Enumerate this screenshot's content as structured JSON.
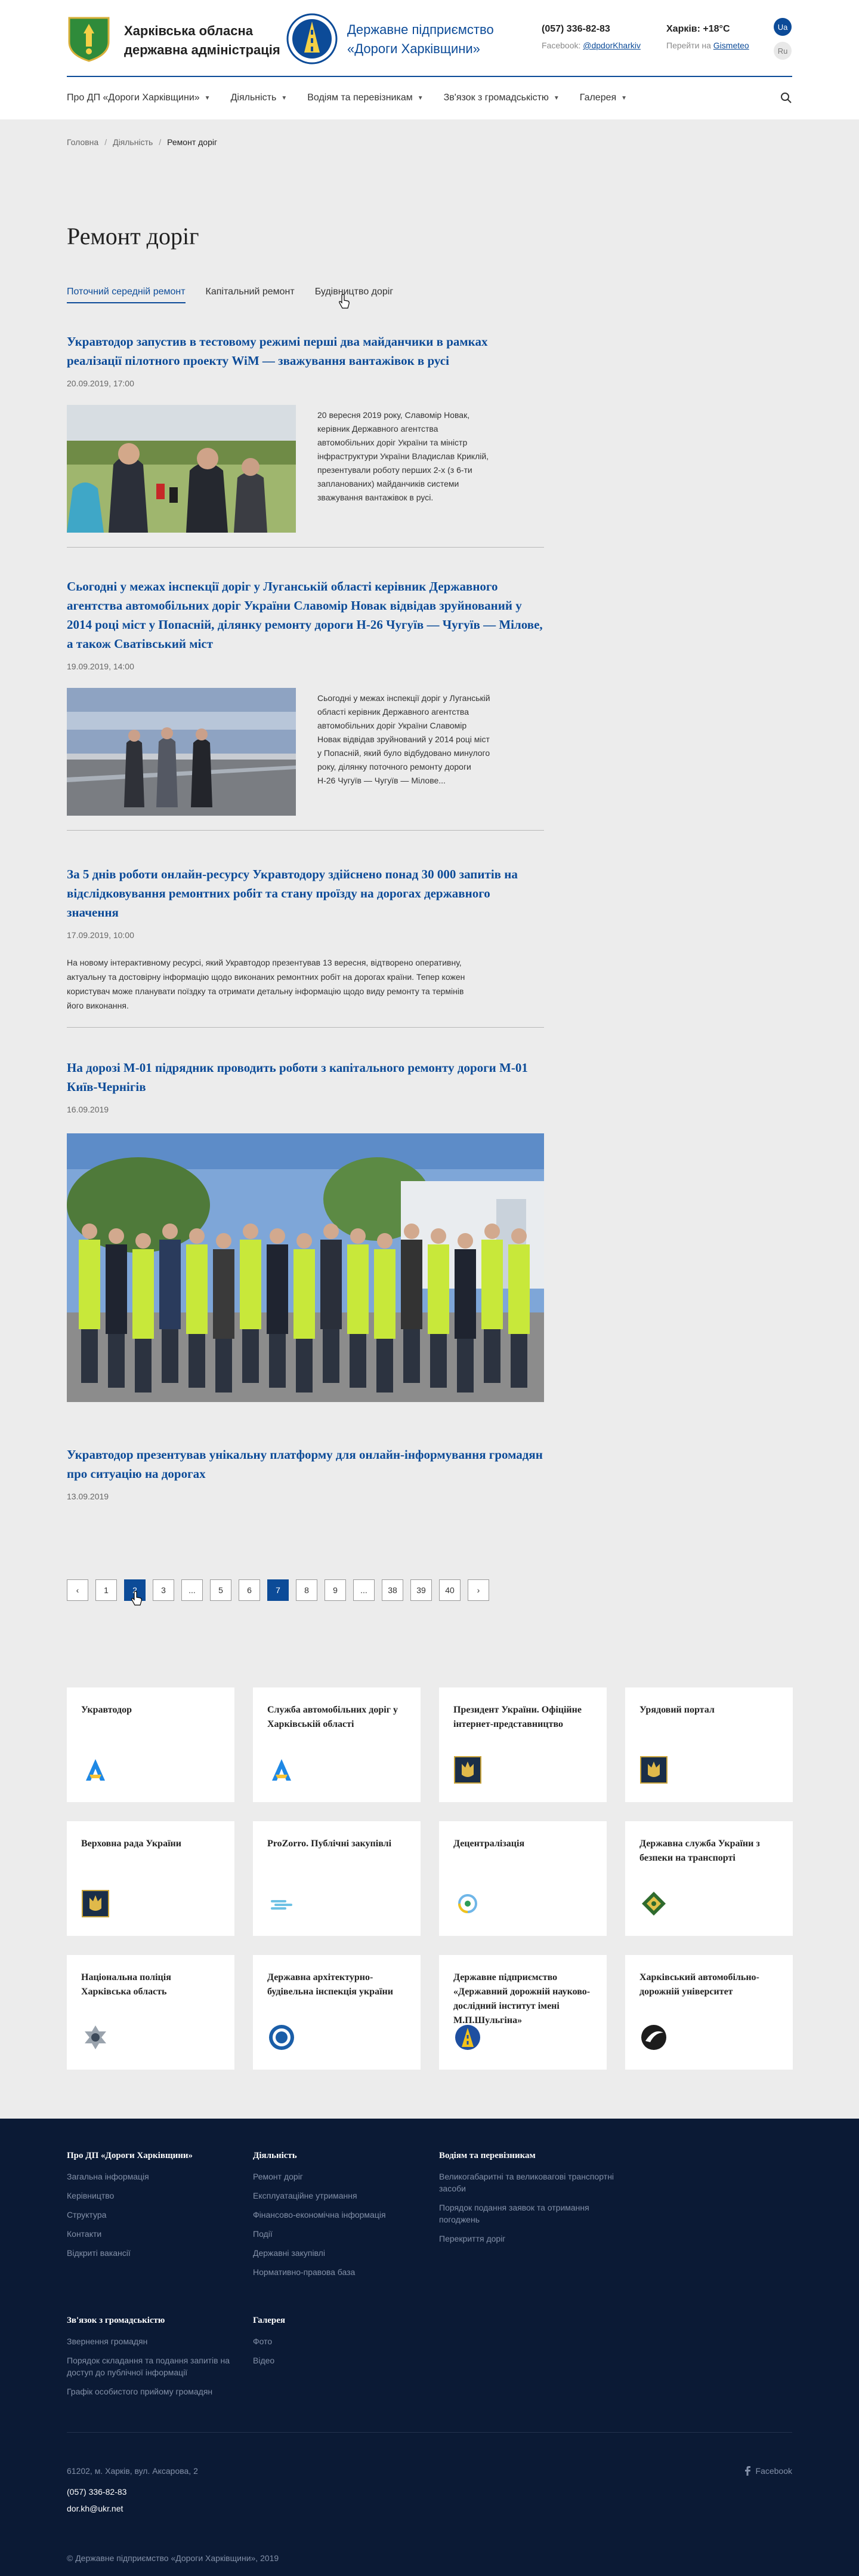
{
  "header": {
    "org1": [
      "Харківська обласна",
      "державна адміністрація"
    ],
    "org2": [
      "Державне підприємство",
      "«Дороги Харківщини»"
    ],
    "phone": "(057) 336-82-83",
    "facebook_prefix": "Facebook: ",
    "facebook_handle": "@dpdorKharkiv",
    "weather": "Харків: +18°C",
    "gismeteo_prefix": "Перейти на ",
    "gismeteo_link": "Gismeteo",
    "lang_ua": "Ua",
    "lang_ru": "Ru"
  },
  "nav": [
    {
      "label": "Про ДП «Дороги Харківщини»"
    },
    {
      "label": "Діяльність"
    },
    {
      "label": "Водіям та перевізникам"
    },
    {
      "label": "Зв'язок з громадськістю"
    },
    {
      "label": "Галерея"
    }
  ],
  "breadcrumb": [
    "Головна",
    "Діяльність",
    "Ремонт доріг"
  ],
  "page_title": "Ремонт доріг",
  "tabs": [
    "Поточний середній ремонт",
    "Капітальний ремонт",
    "Будівництво доріг"
  ],
  "articles": [
    {
      "title": "Укравтодор запустив в тестовому режимі перші два майданчики в рамках реалізації пілотного проекту WiM — зважування вантажівок в русі",
      "date": "20.09.2019, 17:00",
      "excerpt": "20 вересня 2019 року, Славомір Новак, керівник Державного агентства автомобільних доріг України та міністр інфраструктури України Владислав Криклій, презентували роботу перших 2-х (з 6-ти запланованих) майданчиків системи зважування вантажівок в русі."
    },
    {
      "title": "Сьогодні у межах інспекції доріг у Луганській області керівник Державного агентства автомобільних доріг України Славомір Новак відвідав зруйнований у 2014 році міст у Попасній, ділянку ремонту дороги Н-26 Чугуїв — Чугуїв — Мілове, а також Сватівський міст",
      "date": "19.09.2019, 14:00",
      "excerpt": "Сьогодні у межах інспекції доріг у Луганській області керівник Державного агентства автомобільних доріг України Славомір Новак відвідав зруйнований у 2014 році міст у Попасній, який було відбудовано минулого року, ділянку поточного ремонту дороги Н-26 Чугуїв — Чугуїв — Мілове..."
    },
    {
      "title": "За 5 днів роботи онлайн-ресурсу Укравтодору здійснено понад 30 000 запитів на відслідковування ремонтних робіт та стану проїзду на дорогах державного значення",
      "date": "17.09.2019, 10:00",
      "excerpt": "На новому інтерактивному ресурсі, який Укравтодор презентував 13 вересня, відтворено оперативну, актуальну та достовірну інформацію щодо виконаних ремонтних робіт на дорогах країни. Тепер кожен користувач може планувати поїздку та отримати детальну інформацію щодо виду ремонту та термінів його виконання."
    },
    {
      "title": "На дорозі М-01 підрядник проводить роботи з капітального ремонту дороги М-01 Київ-Чернігів",
      "date": "16.09.2019"
    },
    {
      "title": "Укравтодор презентував унікальну платформу для онлайн-інформування громадян про ситуацію на дорогах",
      "date": "13.09.2019"
    }
  ],
  "pagination": [
    "‹",
    "1",
    "2",
    "3",
    "...",
    "5",
    "6",
    "7",
    "8",
    "9",
    "...",
    "38",
    "39",
    "40",
    "›"
  ],
  "partners": [
    {
      "title": "Укравтодор",
      "icon": "ukravtodor-logo-icon"
    },
    {
      "title": "Служба автомобільних доріг у Харківській області",
      "icon": "ukravtodor-logo-icon"
    },
    {
      "title": "Президент України. Офіційне інтернет-представництво",
      "icon": "trident-icon"
    },
    {
      "title": "Урядовий портал",
      "icon": "trident-icon"
    },
    {
      "title": "Верховна рада України",
      "icon": "trident-icon"
    },
    {
      "title": "ProZorro. Публічні закупівлі",
      "icon": "prozorro-icon"
    },
    {
      "title": "Децентралізація",
      "icon": "decentralization-icon"
    },
    {
      "title": "Державна служба України з безпеки на транспорті",
      "icon": "transport-safety-icon"
    },
    {
      "title": "Національна поліція Харківська область",
      "icon": "police-icon"
    },
    {
      "title": "Державна архітектурно-будівельна інспекція україни",
      "icon": "dabi-icon"
    },
    {
      "title": "Державне підприємство «Державний дорожній науково-дослідний інститут імені М.П.Шульгіна»",
      "icon": "road-institute-icon"
    },
    {
      "title": "Харківський автомобільно-дорожній університет",
      "icon": "university-icon"
    }
  ],
  "footer": {
    "col1": {
      "title": "Про ДП «Дороги Харківщини»",
      "links": [
        "Загальна інформація",
        "Керівництво",
        "Структура",
        "Контакти",
        "Відкриті вакансії"
      ]
    },
    "col2": {
      "title": "Діяльність",
      "links": [
        "Ремонт доріг",
        "Експлуатаційне утримання",
        "Фінансово-економічна інформація",
        "Події",
        "Державні закупівлі",
        "Нормативно-правова база"
      ]
    },
    "col3": {
      "title": "Водіям та перевізникам",
      "links": [
        "Великогабаритні та великовагові транспортні засоби",
        "Порядок подання заявок та отримання погоджень",
        "Перекриття доріг"
      ]
    },
    "col4": {
      "title": "Зв'язок з громадськістю",
      "links": [
        "Звернення громадян",
        "Порядок складання та подання запитів на доступ до публічної інформації",
        "Графік особистого прийому громадян"
      ]
    },
    "col5": {
      "title": "Галерея",
      "links": [
        "Фото",
        "Відео"
      ]
    },
    "address": "61202, м. Харків, вул. Аксарова, 2",
    "phone": "(057) 336-82-83",
    "email": "dor.kh@ukr.net",
    "facebook": "Facebook",
    "copyright": "© Державне підприємство «Дороги Харківщини», 2019"
  },
  "colors": {
    "accent": "#0c4b98",
    "footer_bg": "#0b1a35",
    "page_bg": "#ececec"
  }
}
